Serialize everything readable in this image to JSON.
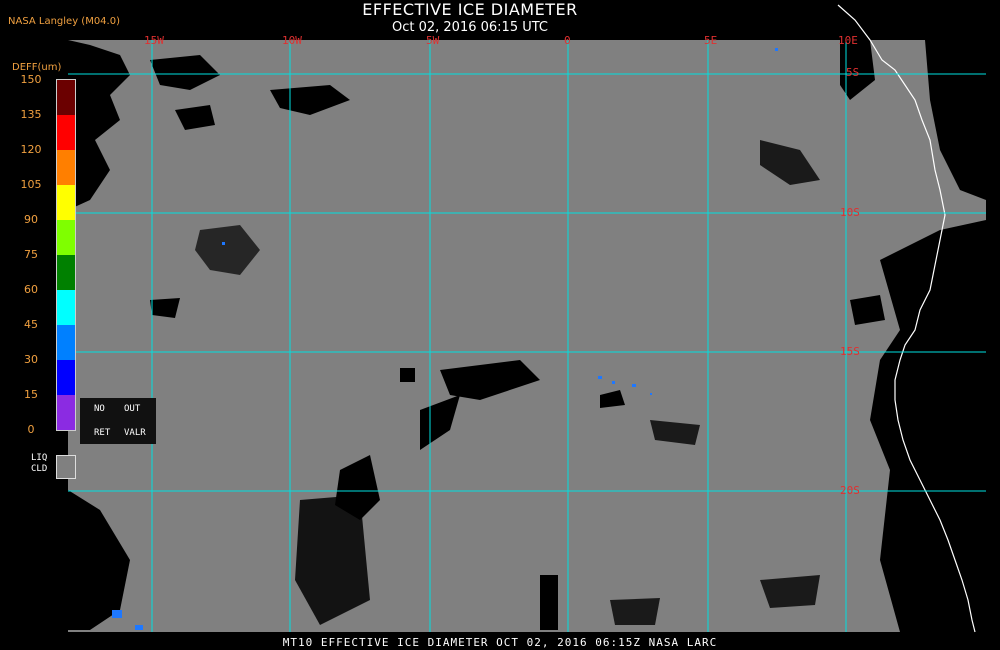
{
  "header": {
    "provider": "NASA Langley (M04.0)",
    "title": "EFFECTIVE ICE DIAMETER",
    "subtitle": "Oct 02, 2016 06:15 UTC"
  },
  "scale": {
    "label": "DEFF(um)",
    "ticks": [
      "150",
      "135",
      "120",
      "105",
      "90",
      "75",
      "60",
      "45",
      "30",
      "15",
      "0"
    ],
    "colors": [
      "#6b0000",
      "#ff0000",
      "#ff7f00",
      "#ffff00",
      "#7fff00",
      "#008000",
      "#00ffff",
      "#0080ff",
      "#0000ff",
      "#8b2be2"
    ]
  },
  "legend": {
    "no": "NO",
    "out": "OUT",
    "ret": "RET",
    "valr": "VALR",
    "liq": "LIQ",
    "cld": "CLD",
    "liq_color": "#808080"
  },
  "grid": {
    "lon_labels": [
      "15W",
      "10W",
      "5W",
      "0",
      "5E",
      "10E"
    ],
    "lat_labels": [
      "5S",
      "10S",
      "15S",
      "20S"
    ],
    "grid_color": "#00e0e0",
    "land_color": "#000000",
    "coast_color": "#ffffff"
  },
  "footer": {
    "text": "MT10  EFFECTIVE ICE DIAMETER   OCT 02, 2016 06:15Z   NASA LARC"
  }
}
